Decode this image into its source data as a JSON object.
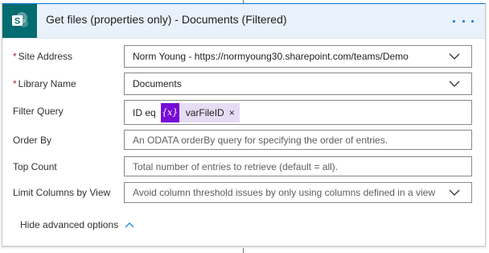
{
  "action": {
    "title": "Get files (properties only) - Documents (Filtered)",
    "icon": "sharepoint-icon",
    "menu_icon": "more-options-icon",
    "accent_color": "#0078d4",
    "header_bg": "#e9f1fb",
    "icon_bg": "#036c70"
  },
  "fields": {
    "site_address": {
      "label": "Site Address",
      "required": true,
      "required_mark": "*",
      "value": "Norm Young - https://normyoung30.sharepoint.com/teams/Demo",
      "control": "dropdown"
    },
    "library_name": {
      "label": "Library Name",
      "required": true,
      "required_mark": "*",
      "value": "Documents",
      "control": "dropdown"
    },
    "filter_query": {
      "label": "Filter Query",
      "prefix_text": "ID eq",
      "token": {
        "icon_text": "{x}",
        "label": "varFileID",
        "remove_glyph": "×",
        "color": "#770bd6"
      }
    },
    "order_by": {
      "label": "Order By",
      "placeholder": "An ODATA orderBy query for specifying the order of entries."
    },
    "top_count": {
      "label": "Top Count",
      "placeholder": "Total number of entries to retrieve (default = all)."
    },
    "limit_columns": {
      "label": "Limit Columns by View",
      "placeholder": "Avoid column threshold issues by only using columns defined in a view",
      "control": "dropdown"
    }
  },
  "advanced_toggle": {
    "label": "Hide advanced options",
    "icon": "chevron-up-icon"
  }
}
